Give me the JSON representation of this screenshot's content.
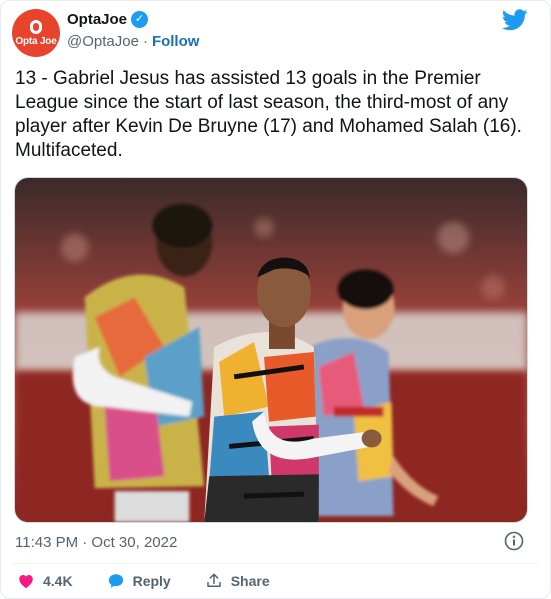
{
  "account": {
    "logo_text": "Opta Joe",
    "display_name": "OptaJoe",
    "handle": "@OptaJoe",
    "separator": "·",
    "follow_label": "Follow",
    "verified": true
  },
  "tweet": {
    "text": "13 - Gabriel Jesus has assisted 13 goals in the Premier League since the start of last season, the third-most of any player after Kevin De Bruyne (17) and Mohamed Salah (16). Multifaceted.",
    "timestamp": "11:43 PM · Oct 30, 2022"
  },
  "actions": {
    "like_count": "4.4K",
    "reply_label": "Reply",
    "share_label": "Share"
  },
  "colors": {
    "avatar_bg": "#e8432c",
    "twitter_blue": "#1d9bf0",
    "like_pink": "#f91880",
    "follow_blue": "#1b6fb8"
  },
  "icons": [
    "twitter-bird-icon",
    "verified-badge-icon",
    "info-icon",
    "heart-icon",
    "reply-bubble-icon",
    "share-icon"
  ]
}
